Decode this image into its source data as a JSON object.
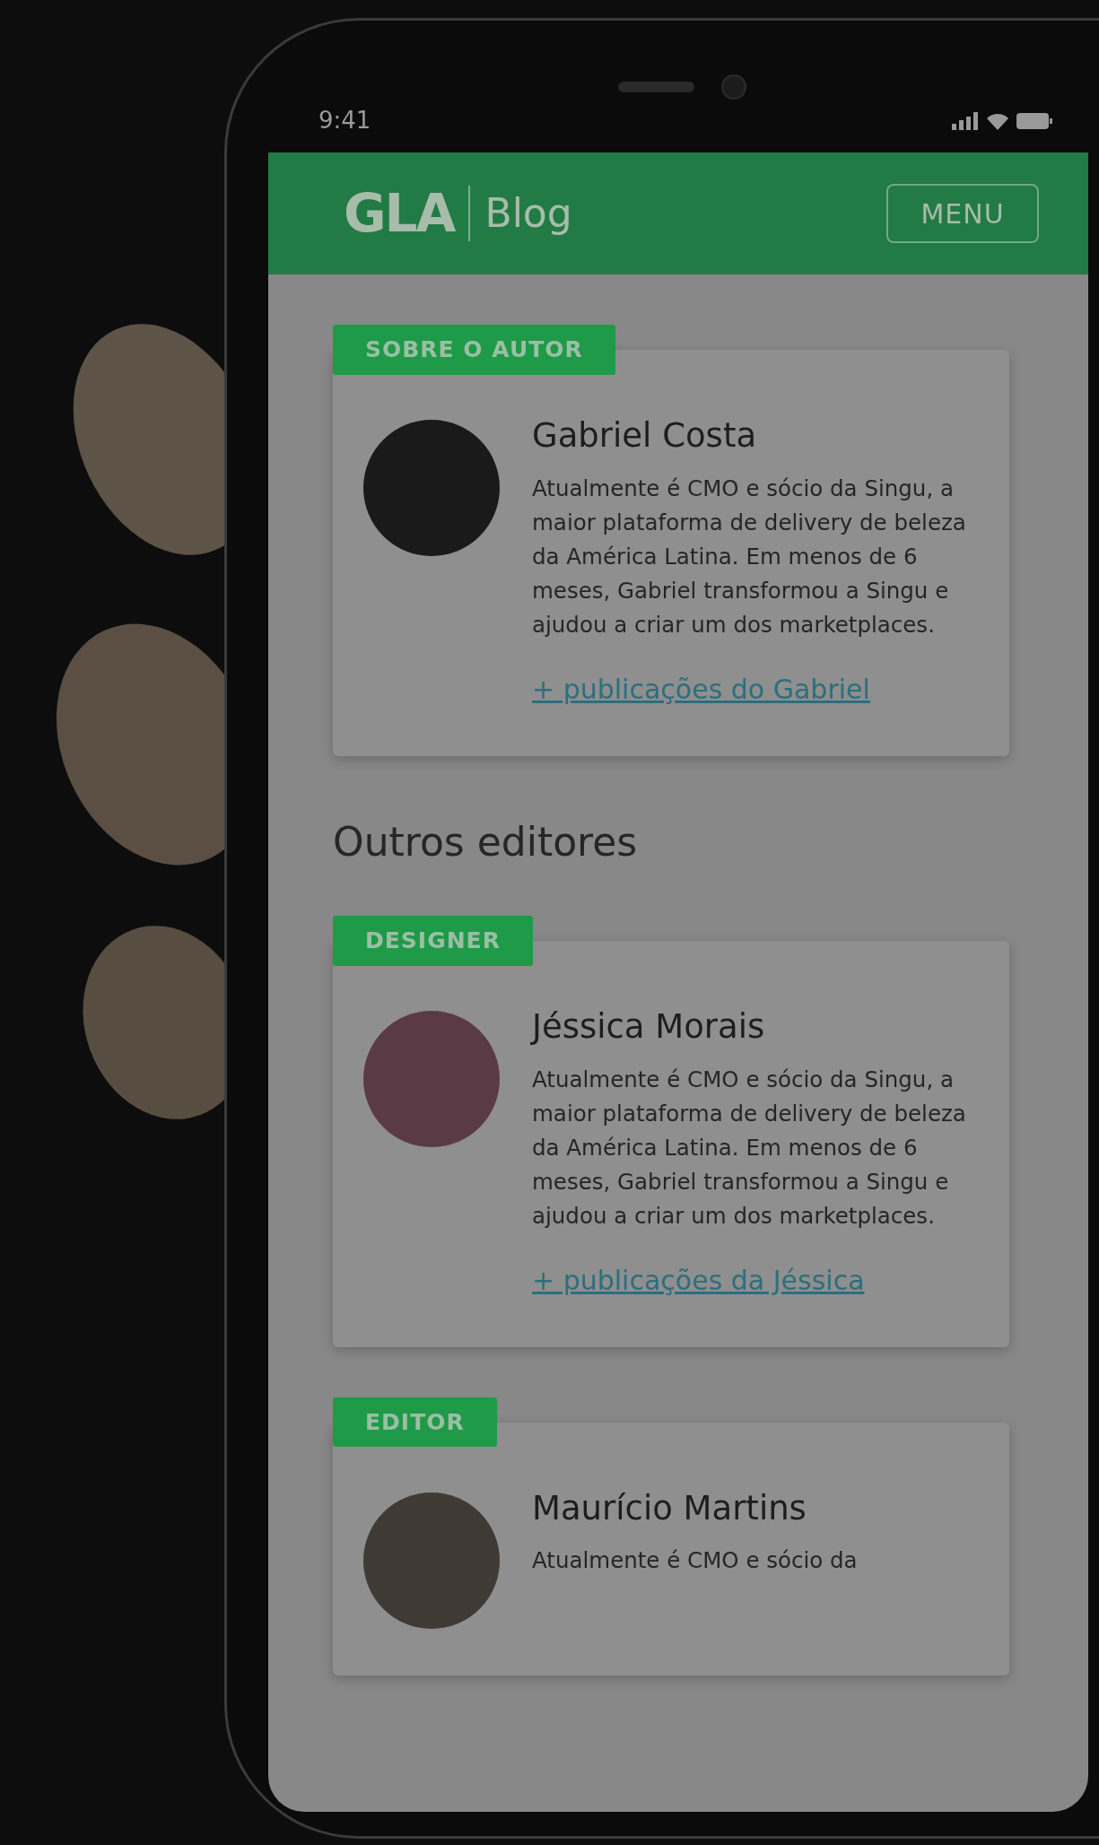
{
  "status_bar": {
    "time": "9:41"
  },
  "header": {
    "logo": "GLA",
    "section": "Blog",
    "menu_button": "MENU"
  },
  "author_card": {
    "badge": "SOBRE O AUTOR",
    "name": "Gabriel Costa",
    "bio": "Atualmente é CMO e sócio da Singu, a maior plataforma de delivery de beleza da América Latina. Em menos de 6 meses, Gabriel transformou a Singu e ajudou a criar um dos marketplaces.",
    "link": "+ publicações do Gabriel"
  },
  "section_title": "Outros editores",
  "editors": [
    {
      "badge": "DESIGNER",
      "name": "Jéssica Morais",
      "bio": "Atualmente é CMO e sócio da Singu, a maior plataforma de delivery de beleza da América Latina. Em menos de 6 meses, Gabriel transformou a Singu e ajudou a criar um dos marketplaces.",
      "link": "+ publicações da Jéssica"
    },
    {
      "badge": "EDITOR",
      "name": "Maurício Martins",
      "bio": "Atualmente é CMO e sócio da"
    }
  ]
}
